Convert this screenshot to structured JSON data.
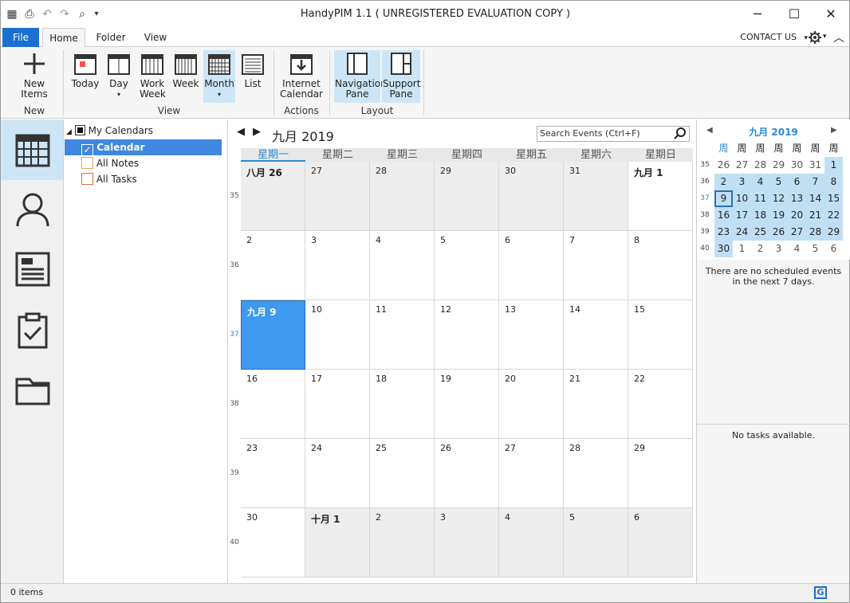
{
  "window": {
    "title": "HandyPIM 1.1 ( UNREGISTERED EVALUATION COPY )"
  },
  "qat": {
    "dropdown_glyph": "▾"
  },
  "tabs": {
    "file": "File",
    "home": "Home",
    "folder": "Folder",
    "view": "View"
  },
  "contact": "CONTACT US",
  "ribbon": {
    "new_items": "New Items",
    "new_group": "New",
    "today": "Today",
    "day": "Day",
    "work_week": "Work Week",
    "week": "Week",
    "month": "Month",
    "list": "List",
    "view_group": "View",
    "internet_calendar": "Internet Calendar",
    "actions_group": "Actions",
    "navigation_pane": "Navigation Pane",
    "support_pane": "Support Pane",
    "layout_group": "Layout"
  },
  "folders": {
    "root": "My Calendars",
    "items": [
      {
        "label": "Calendar",
        "selected": true
      },
      {
        "label": "All Notes"
      },
      {
        "label": "All Tasks"
      }
    ]
  },
  "main": {
    "title": "九月 2019",
    "search_placeholder": "Search Events (Ctrl+F)"
  },
  "calendar": {
    "day_headers": [
      "星期一",
      "星期二",
      "星期三",
      "星期四",
      "星期五",
      "星期六",
      "星期日"
    ],
    "weeks": [
      {
        "num": "35",
        "days": [
          {
            "d": "八月 26",
            "bold": true,
            "gray": true
          },
          {
            "d": "27",
            "gray": true
          },
          {
            "d": "28",
            "gray": true
          },
          {
            "d": "29",
            "gray": true
          },
          {
            "d": "30",
            "gray": true
          },
          {
            "d": "31",
            "gray": true
          },
          {
            "d": "九月 1",
            "bold": true
          }
        ]
      },
      {
        "num": "36",
        "days": [
          {
            "d": "2"
          },
          {
            "d": "3"
          },
          {
            "d": "4"
          },
          {
            "d": "5"
          },
          {
            "d": "6"
          },
          {
            "d": "7"
          },
          {
            "d": "8"
          }
        ]
      },
      {
        "num": "37",
        "days": [
          {
            "d": "九月 9",
            "bold": true,
            "today": true
          },
          {
            "d": "10"
          },
          {
            "d": "11"
          },
          {
            "d": "12"
          },
          {
            "d": "13"
          },
          {
            "d": "14"
          },
          {
            "d": "15"
          }
        ]
      },
      {
        "num": "38",
        "days": [
          {
            "d": "16"
          },
          {
            "d": "17"
          },
          {
            "d": "18"
          },
          {
            "d": "19"
          },
          {
            "d": "20"
          },
          {
            "d": "21"
          },
          {
            "d": "22"
          }
        ]
      },
      {
        "num": "39",
        "days": [
          {
            "d": "23"
          },
          {
            "d": "24"
          },
          {
            "d": "25"
          },
          {
            "d": "26"
          },
          {
            "d": "27"
          },
          {
            "d": "28"
          },
          {
            "d": "29"
          }
        ]
      },
      {
        "num": "40",
        "days": [
          {
            "d": "30"
          },
          {
            "d": "十月 1",
            "bold": true,
            "gray": true
          },
          {
            "d": "2",
            "gray": true
          },
          {
            "d": "3",
            "gray": true
          },
          {
            "d": "4",
            "gray": true
          },
          {
            "d": "5",
            "gray": true
          },
          {
            "d": "6",
            "gray": true
          }
        ]
      }
    ]
  },
  "mini": {
    "title": "九月 2019",
    "headers": [
      "周",
      "周",
      "周",
      "周",
      "周",
      "周",
      "周"
    ],
    "rows": [
      {
        "wk": "35",
        "days": [
          {
            "d": "26",
            "o": true
          },
          {
            "d": "27",
            "o": true
          },
          {
            "d": "28",
            "o": true
          },
          {
            "d": "29",
            "o": true
          },
          {
            "d": "30",
            "o": true
          },
          {
            "d": "31",
            "o": true
          },
          {
            "d": "1"
          }
        ]
      },
      {
        "wk": "36",
        "days": [
          {
            "d": "2"
          },
          {
            "d": "3"
          },
          {
            "d": "4"
          },
          {
            "d": "5"
          },
          {
            "d": "6"
          },
          {
            "d": "7"
          },
          {
            "d": "8"
          }
        ]
      },
      {
        "wk": "37",
        "days": [
          {
            "d": "9",
            "today": true
          },
          {
            "d": "10"
          },
          {
            "d": "11"
          },
          {
            "d": "12"
          },
          {
            "d": "13"
          },
          {
            "d": "14"
          },
          {
            "d": "15"
          }
        ]
      },
      {
        "wk": "38",
        "days": [
          {
            "d": "16"
          },
          {
            "d": "17"
          },
          {
            "d": "18"
          },
          {
            "d": "19"
          },
          {
            "d": "20"
          },
          {
            "d": "21"
          },
          {
            "d": "22"
          }
        ]
      },
      {
        "wk": "39",
        "days": [
          {
            "d": "23"
          },
          {
            "d": "24"
          },
          {
            "d": "25"
          },
          {
            "d": "26"
          },
          {
            "d": "27"
          },
          {
            "d": "28"
          },
          {
            "d": "29"
          }
        ]
      },
      {
        "wk": "40",
        "days": [
          {
            "d": "30"
          },
          {
            "d": "1",
            "o": true
          },
          {
            "d": "2",
            "o": true
          },
          {
            "d": "3",
            "o": true
          },
          {
            "d": "4",
            "o": true
          },
          {
            "d": "5",
            "o": true
          },
          {
            "d": "6",
            "o": true
          }
        ]
      }
    ]
  },
  "support": {
    "no_events": "There are no scheduled events in the next 7 days.",
    "no_tasks": "No tasks available."
  },
  "status": {
    "items": "0 items"
  },
  "colors": {
    "accent": "#1a6fd0",
    "selected": "#cde6f7",
    "today": "#3e99f0"
  }
}
